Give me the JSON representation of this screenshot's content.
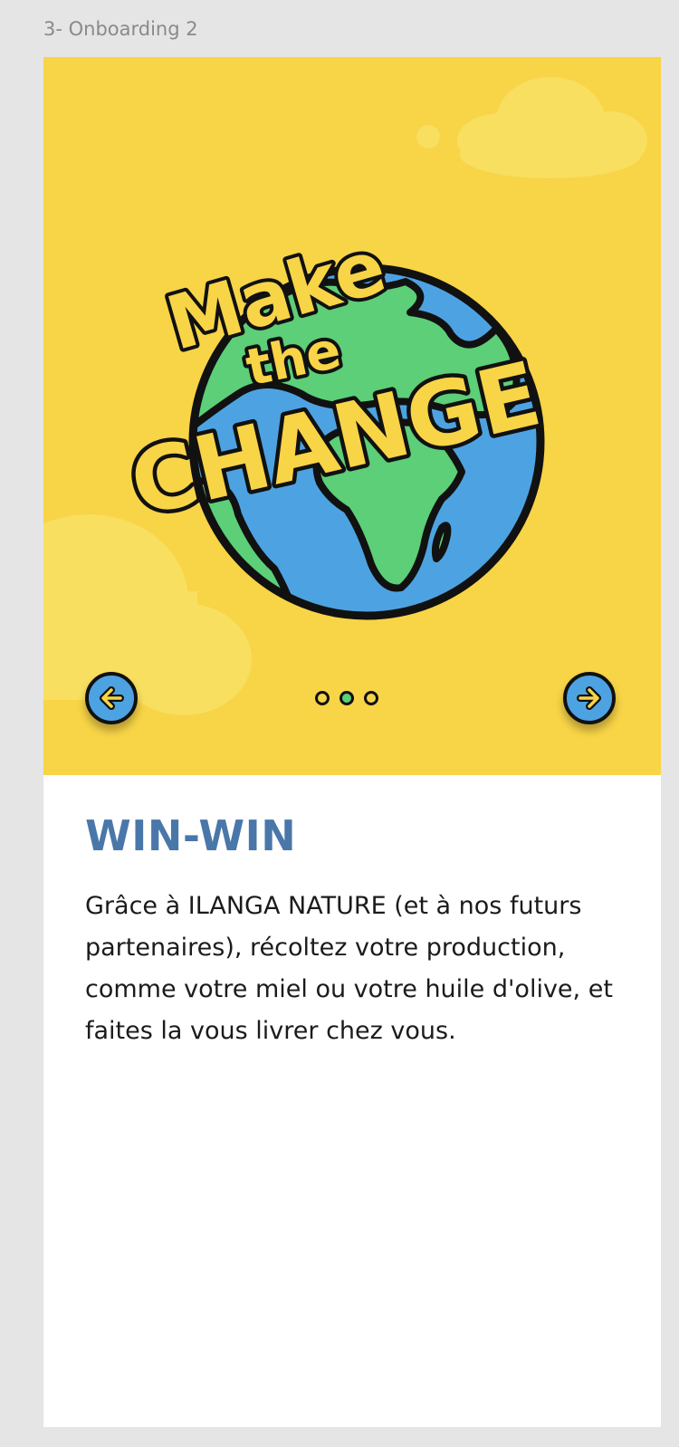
{
  "frame": {
    "label": "3- Onboarding 2"
  },
  "hero": {
    "badge_lines": [
      "Make",
      "the",
      "CHANGE"
    ],
    "prev_icon": "arrow-left-icon",
    "next_icon": "arrow-right-icon",
    "pagination": {
      "total": 3,
      "active_index": 1
    },
    "colors": {
      "background": "#f8d447",
      "cloud": "#f8df60",
      "ocean": "#4da3e2",
      "land": "#5ccf78",
      "outline": "#111111",
      "button": "#4da3e2"
    }
  },
  "content": {
    "title": "WIN-WIN",
    "body": "Grâce à ILANGA NATURE (et à nos futurs partenaires), récoltez votre production, comme votre miel ou votre huile d'olive, et faites la vous livrer chez vous."
  },
  "colors": {
    "title": "#4a77a9",
    "text": "#1b1b1b",
    "canvas": "#e5e5e5"
  }
}
